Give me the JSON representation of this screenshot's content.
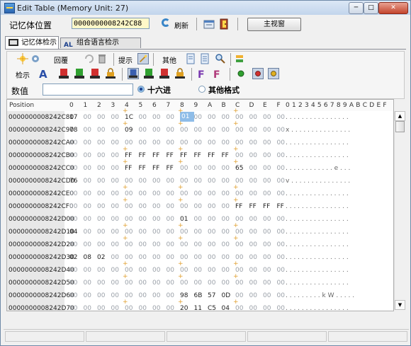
{
  "window": {
    "title": "Edit Table (Memory Unit: 27)",
    "min": "─",
    "max": "□",
    "close": "✕"
  },
  "toolbar": {
    "addr_label": "记忆体位置",
    "addr_value": "0000000008242C88",
    "refresh_label": "刷新",
    "main_view_label": "主视窗"
  },
  "tabs": [
    {
      "label": "记忆体检示"
    },
    {
      "label": "组合语言检示"
    }
  ],
  "toolbox": {
    "row1": {
      "review": "回覆",
      "hint": "提示",
      "other": "其他"
    },
    "row2": {
      "show": "检示"
    },
    "number_label": "数值",
    "radio_hex": "十六进",
    "radio_other": "其他格式"
  },
  "grid": {
    "header_position": "Position",
    "hex_columns": [
      "0",
      "1",
      "2",
      "3",
      "4",
      "5",
      "6",
      "7",
      "8",
      "9",
      "A",
      "B",
      "C",
      "D",
      "E",
      "F"
    ],
    "ascii_header": "0 1 2 3 4 5 6 7 8 9 A B C D E F",
    "rows": [
      {
        "addr": "0000000008242C80",
        "bytes": [
          "17",
          "00",
          "00",
          "00",
          "1C",
          "00",
          "00",
          "00",
          "01",
          "00",
          "00",
          "00",
          "00",
          "00",
          "00",
          "00"
        ],
        "ascii": ". . . . . . . . . . . . . . . ."
      },
      {
        "addr": "0000000008242C90",
        "bytes": [
          "78",
          "00",
          "00",
          "00",
          "09",
          "00",
          "00",
          "00",
          "00",
          "00",
          "00",
          "00",
          "00",
          "00",
          "00",
          "00"
        ],
        "ascii": "x . . . . . . . . . . . . . . ."
      },
      {
        "addr": "0000000008242CA0",
        "bytes": [
          "00",
          "00",
          "00",
          "00",
          "00",
          "00",
          "00",
          "00",
          "00",
          "00",
          "00",
          "00",
          "00",
          "00",
          "00",
          "00"
        ],
        "ascii": ". . . . . . . . . . . . . . . ."
      },
      {
        "addr": "0000000008242CB0",
        "bytes": [
          "00",
          "00",
          "00",
          "00",
          "FF",
          "FF",
          "FF",
          "FF",
          "FF",
          "FF",
          "FF",
          "FF",
          "00",
          "00",
          "00",
          "00"
        ],
        "ascii": ". . . . . . . . . . . . . . . ."
      },
      {
        "addr": "0000000008242CC0",
        "bytes": [
          "00",
          "00",
          "00",
          "00",
          "FF",
          "FF",
          "FF",
          "FF",
          "00",
          "00",
          "00",
          "00",
          "65",
          "00",
          "00",
          "00"
        ],
        "ascii": ". . . . . . . . . . . . e . . ."
      },
      {
        "addr": "0000000008242CD0",
        "bytes": [
          "76",
          "00",
          "00",
          "00",
          "00",
          "00",
          "00",
          "00",
          "00",
          "00",
          "00",
          "00",
          "00",
          "00",
          "00",
          "00"
        ],
        "ascii": "v . . . . . . . . . . . . . . ."
      },
      {
        "addr": "0000000008242CE0",
        "bytes": [
          "00",
          "00",
          "00",
          "00",
          "00",
          "00",
          "00",
          "00",
          "00",
          "00",
          "00",
          "00",
          "00",
          "00",
          "00",
          "00"
        ],
        "ascii": ". . . . . . . . . . . . . . . ."
      },
      {
        "addr": "0000000008242CF0",
        "bytes": [
          "00",
          "00",
          "00",
          "00",
          "00",
          "00",
          "00",
          "00",
          "00",
          "00",
          "00",
          "00",
          "FF",
          "FF",
          "FF",
          "FF"
        ],
        "ascii": ". . . . . . . . . . . . . . . ."
      },
      {
        "addr": "0000000008242D00",
        "bytes": [
          "00",
          "00",
          "00",
          "00",
          "00",
          "00",
          "00",
          "00",
          "01",
          "00",
          "00",
          "00",
          "00",
          "00",
          "00",
          "00"
        ],
        "ascii": ". . . . . . . . . . . . . . . ."
      },
      {
        "addr": "0000000008242D10",
        "bytes": [
          "04",
          "00",
          "00",
          "00",
          "00",
          "00",
          "00",
          "00",
          "00",
          "00",
          "00",
          "00",
          "00",
          "00",
          "00",
          "00"
        ],
        "ascii": ". . . . . . . . . . . . . . . ."
      },
      {
        "addr": "0000000008242D20",
        "bytes": [
          "00",
          "00",
          "00",
          "00",
          "00",
          "00",
          "00",
          "00",
          "00",
          "00",
          "00",
          "00",
          "00",
          "00",
          "00",
          "00"
        ],
        "ascii": ". . . . . . . . . . . . . . . ."
      },
      {
        "addr": "0000000008242D30",
        "bytes": [
          "02",
          "08",
          "02",
          "00",
          "00",
          "00",
          "00",
          "00",
          "00",
          "00",
          "00",
          "00",
          "00",
          "00",
          "00",
          "00"
        ],
        "ascii": ". . . . . . . . . . . . . . . ."
      },
      {
        "addr": "0000000008242D40",
        "bytes": [
          "00",
          "00",
          "00",
          "00",
          "00",
          "00",
          "00",
          "00",
          "00",
          "00",
          "00",
          "00",
          "00",
          "00",
          "00",
          "00"
        ],
        "ascii": ". . . . . . . . . . . . . . . ."
      },
      {
        "addr": "0000000008242D50",
        "bytes": [
          "00",
          "00",
          "00",
          "00",
          "00",
          "00",
          "00",
          "00",
          "00",
          "00",
          "00",
          "00",
          "00",
          "00",
          "00",
          "00"
        ],
        "ascii": ". . . . . . . . . . . . . . . ."
      },
      {
        "addr": "0000000008242D60",
        "bytes": [
          "00",
          "00",
          "00",
          "00",
          "00",
          "00",
          "00",
          "00",
          "98",
          "6B",
          "57",
          "0D",
          "00",
          "00",
          "00",
          "00"
        ],
        "ascii": ". . . . . . . . . k W . . . . ."
      },
      {
        "addr": "0000000008242D70",
        "bytes": [
          "00",
          "00",
          "00",
          "00",
          "00",
          "00",
          "00",
          "00",
          "20",
          "11",
          "C5",
          "04",
          "00",
          "00",
          "00",
          "00"
        ],
        "ascii": ". . . . . . . . . . . . . . . ."
      }
    ],
    "selected": {
      "row": 0,
      "col": 8
    }
  },
  "colors": {
    "selected": "#8fbde8",
    "zero_byte": "#9aa0a8",
    "marker": "#e0a030"
  }
}
